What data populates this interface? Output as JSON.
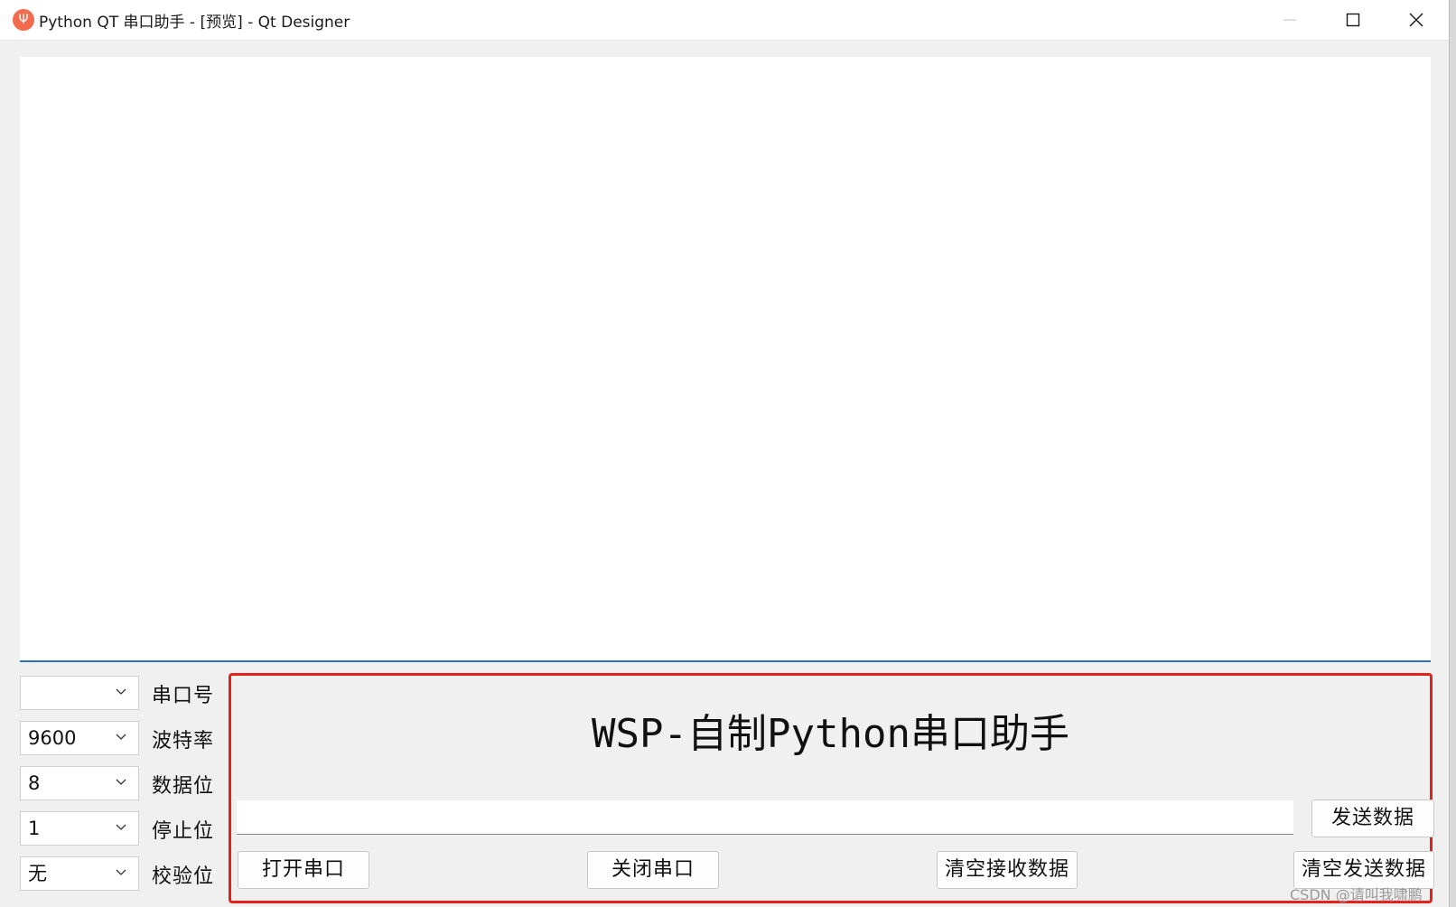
{
  "window": {
    "title": "Python QT 串口助手 - [预览] - Qt Designer",
    "icon": "usb-icon",
    "accent_color": "#2a6fc9",
    "highlight_color": "#e8201a"
  },
  "settings": {
    "port": {
      "value": "",
      "label": "串口号"
    },
    "baud": {
      "value": "9600",
      "label": "波特率"
    },
    "databits": {
      "value": "8",
      "label": "数据位"
    },
    "stopbits": {
      "value": "1",
      "label": "停止位"
    },
    "parity": {
      "value": "无",
      "label": "校验位"
    }
  },
  "panel": {
    "title": "WSP-自制Python串口助手",
    "send_value": "",
    "send_button": "发送数据",
    "open_button": "打开串口",
    "close_button": "关闭串口",
    "clear_receive_button": "清空接收数据",
    "clear_send_button": "清空发送数据"
  },
  "watermark": "CSDN @请叫我啸鹏"
}
